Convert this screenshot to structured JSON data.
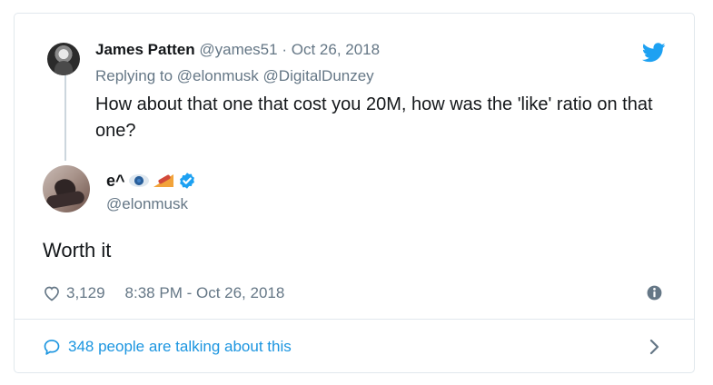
{
  "parent_tweet": {
    "author_name": "James Patten",
    "author_handle": "@yames51",
    "separator": "·",
    "date": "Oct 26, 2018",
    "replying_prefix": "Replying to",
    "replying_to_1": "@elonmusk",
    "replying_to_2": "@DigitalDunzey",
    "text": "How about that one that cost you 20M, how was the 'like' ratio on that one?"
  },
  "main_tweet": {
    "author_name": "e^",
    "author_emojis": [
      "eye-emoji",
      "pie-emoji"
    ],
    "verified": true,
    "author_handle": "@elonmusk",
    "text": "Worth it",
    "like_count": "3,129",
    "timestamp": "8:38 PM - Oct 26, 2018"
  },
  "footer": {
    "talking_text": "348 people are talking about this"
  },
  "colors": {
    "twitter_blue": "#1da1f2",
    "link_blue": "#1b95e0",
    "secondary_text": "#657786",
    "primary_text": "#14171a",
    "border": "#e1e8ed"
  },
  "icons": {
    "brand": "twitter-bird-icon",
    "verified": "verified-badge-icon",
    "like": "heart-icon",
    "info": "info-icon",
    "reply": "speech-bubble-icon",
    "more": "chevron-right-icon"
  }
}
